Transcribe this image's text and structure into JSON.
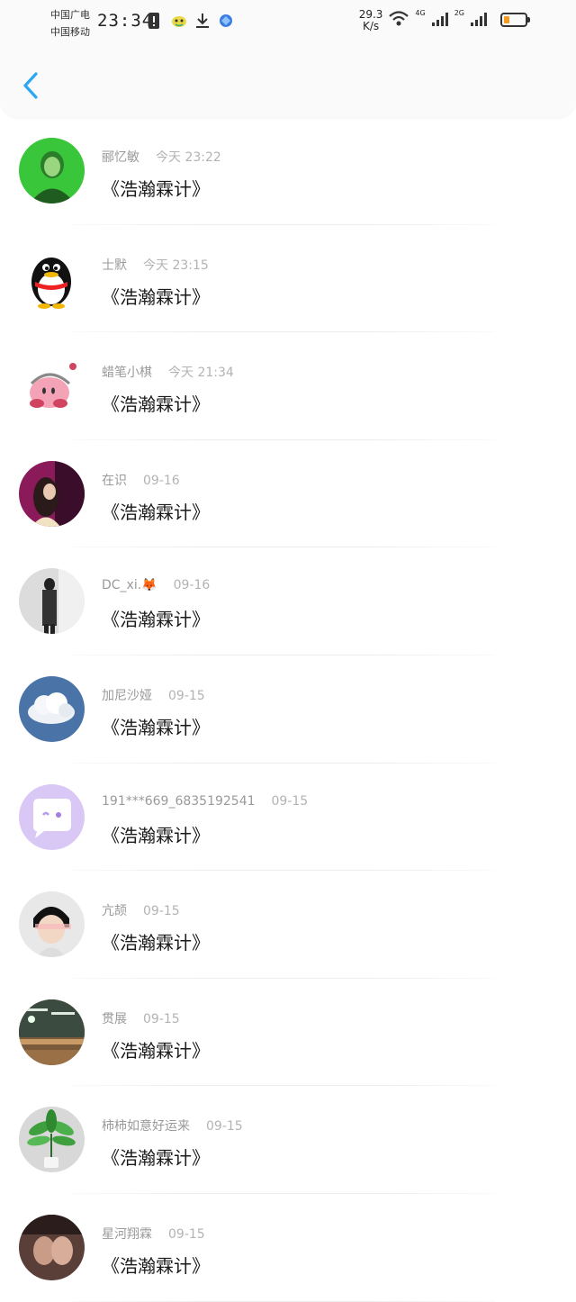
{
  "status_bar": {
    "carrier_1": "中国广电",
    "carrier_2": "中国移动",
    "time": "23:34",
    "speed_value": "29.3",
    "speed_unit": "K/s",
    "net_1": "4G",
    "net_2": "2G",
    "battery_color": "#f39c1f",
    "battery_level": 0.25
  },
  "nav": {
    "back_icon": "chevron-left-icon",
    "accent": "#2aa6f2"
  },
  "messages": [
    {
      "name": "郦忆敏",
      "time": "今天 23:22",
      "title": "《浩瀚霖计》",
      "avatar": "photo-green"
    },
    {
      "name": "士默",
      "time": "今天 23:15",
      "title": "《浩瀚霖计》",
      "avatar": "penguin"
    },
    {
      "name": "蜡笔小棋",
      "time": "今天 21:34",
      "title": "《浩瀚霖计》",
      "avatar": "kirby"
    },
    {
      "name": "在识",
      "time": "09-16",
      "title": "《浩瀚霖计》",
      "avatar": "photo-purple"
    },
    {
      "name": "DC_xi.🦊",
      "time": "09-16",
      "title": "《浩瀚霖计》",
      "avatar": "photo-grey"
    },
    {
      "name": "加尼沙娅",
      "time": "09-15",
      "title": "《浩瀚霖计》",
      "avatar": "cloud"
    },
    {
      "name": "191***669_6835192541",
      "time": "09-15",
      "title": "《浩瀚霖计》",
      "avatar": "chat-bubble"
    },
    {
      "name": "亢颉",
      "time": "09-15",
      "title": "《浩瀚霖计》",
      "avatar": "photo-face"
    },
    {
      "name": "贯展",
      "time": "09-15",
      "title": "《浩瀚霖计》",
      "avatar": "classroom"
    },
    {
      "name": "柿柿如意好运来",
      "time": "09-15",
      "title": "《浩瀚霖计》",
      "avatar": "plant"
    },
    {
      "name": "星河翔霖",
      "time": "09-15",
      "title": "《浩瀚霖计》",
      "avatar": "photo-dark"
    }
  ]
}
